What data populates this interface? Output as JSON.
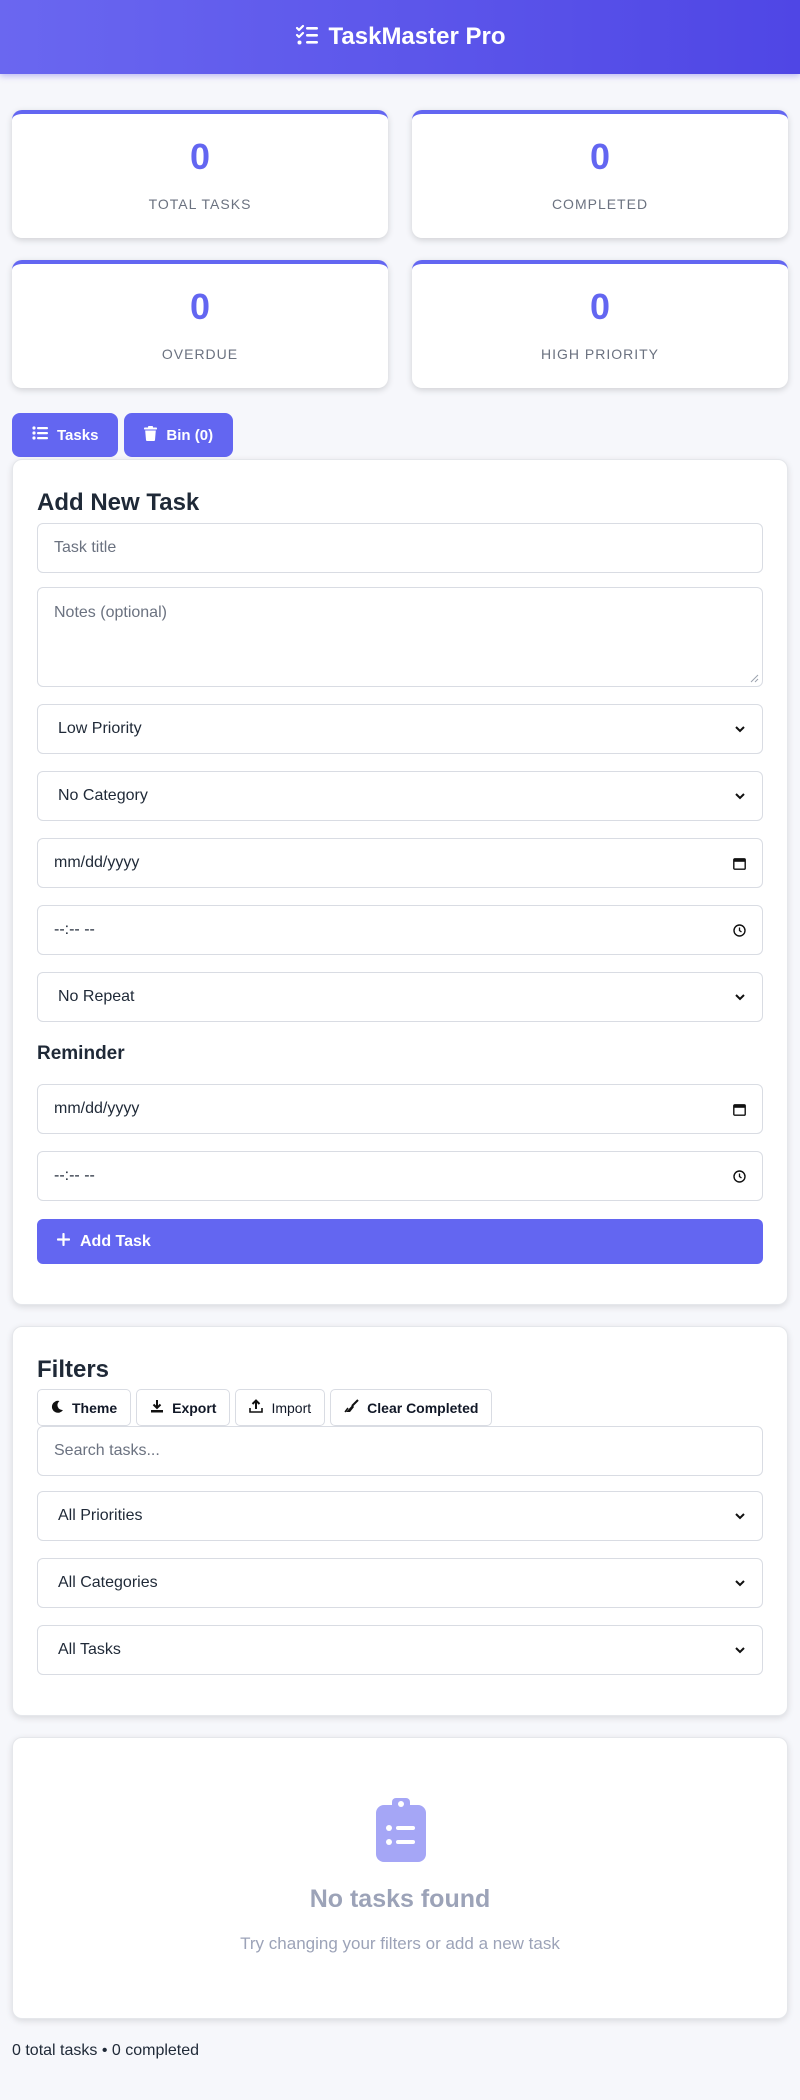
{
  "header": {
    "title": "TaskMaster Pro",
    "icon": "task-list-icon"
  },
  "stats": [
    {
      "value": "0",
      "label": "TOTAL TASKS"
    },
    {
      "value": "0",
      "label": "COMPLETED"
    },
    {
      "value": "0",
      "label": "OVERDUE"
    },
    {
      "value": "0",
      "label": "HIGH PRIORITY"
    }
  ],
  "tabs": [
    {
      "label": "Tasks",
      "icon": "list-icon"
    },
    {
      "label": "Bin (0)",
      "icon": "trash-icon"
    }
  ],
  "add_task": {
    "title": "Add New Task",
    "title_placeholder": "Task title",
    "notes_placeholder": "Notes (optional)",
    "priority_value": "Low Priority",
    "category_value": "No Category",
    "date_value": "mm/dd/yyyy",
    "time_value": "--:-- --",
    "repeat_value": "No Repeat",
    "reminder_heading": "Reminder",
    "reminder_date_value": "mm/dd/yyyy",
    "reminder_time_value": "--:-- --",
    "submit_label": "Add Task"
  },
  "filters": {
    "title": "Filters",
    "buttons": {
      "theme": "Theme",
      "export": "Export",
      "import": "Import",
      "clear_completed": "Clear Completed"
    },
    "search_placeholder": "Search tasks...",
    "priority_value": "All Priorities",
    "category_value": "All Categories",
    "status_value": "All Tasks"
  },
  "empty_state": {
    "title": "No tasks found",
    "subtitle": "Try changing your filters or add a new task",
    "icon": "clipboard-list-icon"
  },
  "footer": {
    "summary": "0 total tasks • 0 completed"
  },
  "colors": {
    "accent": "#6366f1",
    "header_gradient_start": "#6a67f0",
    "header_gradient_end": "#4f46e5",
    "page_bg": "#f6f7fb",
    "muted_text": "#9ca3b8"
  }
}
